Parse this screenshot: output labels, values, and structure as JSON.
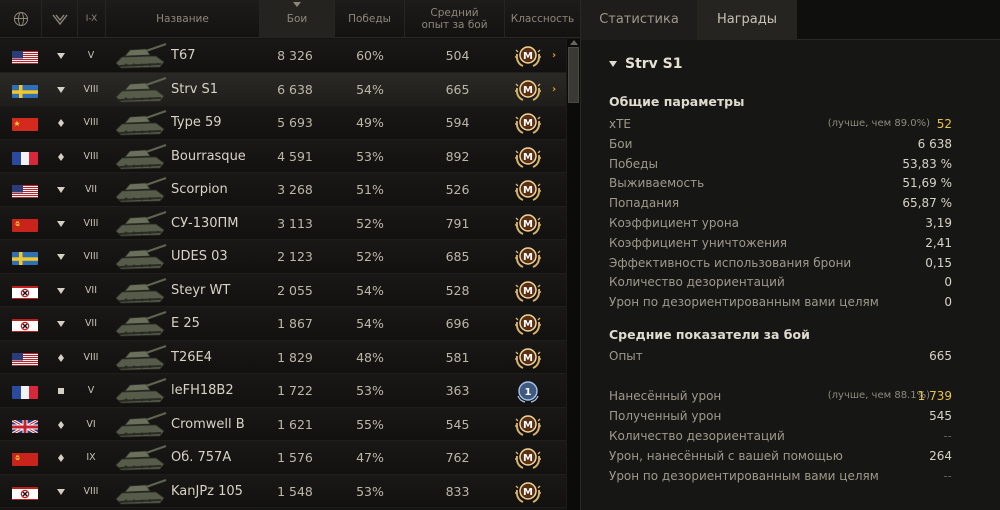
{
  "table": {
    "headers": {
      "nation": "globe-icon",
      "type": "vehicle-type-icon",
      "tier": "I-X",
      "name": "Название",
      "battles": "Бои",
      "wins": "Победы",
      "avg_xp": "Средний опыт за бой",
      "mastery": "Классность"
    },
    "rows": [
      {
        "flag": "usa",
        "type": "triangle",
        "tier": "V",
        "name": "T67",
        "battles": "8 326",
        "wins": "60%",
        "xp": "504",
        "mastery": "M",
        "arrow": "›",
        "selected": false
      },
      {
        "flag": "sweden",
        "type": "triangle",
        "tier": "VIII",
        "name": "Strv S1",
        "battles": "6 638",
        "wins": "54%",
        "xp": "665",
        "mastery": "M",
        "arrow": "›",
        "selected": true
      },
      {
        "flag": "china",
        "type": "diamond",
        "tier": "VIII",
        "name": "Type 59",
        "battles": "5 693",
        "wins": "49%",
        "xp": "594",
        "mastery": "M",
        "arrow": "",
        "selected": false
      },
      {
        "flag": "france",
        "type": "diamond",
        "tier": "VIII",
        "name": "Bourrasque",
        "battles": "4 591",
        "wins": "53%",
        "xp": "892",
        "mastery": "M",
        "arrow": "",
        "selected": false
      },
      {
        "flag": "usa",
        "type": "triangle",
        "tier": "VII",
        "name": "Scorpion",
        "battles": "3 268",
        "wins": "51%",
        "xp": "526",
        "mastery": "M",
        "arrow": "",
        "selected": false
      },
      {
        "flag": "ussr",
        "type": "triangle",
        "tier": "VIII",
        "name": "СУ-130ПМ",
        "battles": "3 113",
        "wins": "52%",
        "xp": "791",
        "mastery": "M",
        "arrow": "",
        "selected": false
      },
      {
        "flag": "sweden",
        "type": "triangle",
        "tier": "VIII",
        "name": "UDES 03",
        "battles": "2 123",
        "wins": "52%",
        "xp": "685",
        "mastery": "M",
        "arrow": "",
        "selected": false
      },
      {
        "flag": "germany",
        "type": "triangle",
        "tier": "VII",
        "name": "Steyr WT",
        "battles": "2 055",
        "wins": "54%",
        "xp": "528",
        "mastery": "M",
        "arrow": "",
        "selected": false
      },
      {
        "flag": "germany",
        "type": "triangle",
        "tier": "VII",
        "name": "E 25",
        "battles": "1 867",
        "wins": "54%",
        "xp": "696",
        "mastery": "M",
        "arrow": "",
        "selected": false
      },
      {
        "flag": "usa",
        "type": "diamond",
        "tier": "VIII",
        "name": "T26E4",
        "battles": "1 829",
        "wins": "48%",
        "xp": "581",
        "mastery": "M",
        "arrow": "",
        "selected": false
      },
      {
        "flag": "france",
        "type": "square",
        "tier": "V",
        "name": "leFH18B2",
        "battles": "1 722",
        "wins": "53%",
        "xp": "363",
        "mastery": "1",
        "arrow": "",
        "selected": false
      },
      {
        "flag": "uk",
        "type": "diamond",
        "tier": "VI",
        "name": "Cromwell B",
        "battles": "1 621",
        "wins": "55%",
        "xp": "545",
        "mastery": "M",
        "arrow": "",
        "selected": false
      },
      {
        "flag": "ussr",
        "type": "diamond",
        "tier": "IX",
        "name": "Об. 757А",
        "battles": "1 576",
        "wins": "47%",
        "xp": "762",
        "mastery": "M",
        "arrow": "",
        "selected": false
      },
      {
        "flag": "germany",
        "type": "triangle",
        "tier": "VIII",
        "name": "KanJPz 105",
        "battles": "1 548",
        "wins": "53%",
        "xp": "833",
        "mastery": "M",
        "arrow": "",
        "selected": false
      }
    ]
  },
  "panel": {
    "tabs": [
      {
        "label": "Статистика",
        "active": true
      },
      {
        "label": "Награды",
        "active": false
      }
    ],
    "vehicle_title": "Strv S1",
    "general": {
      "title": "Общие параметры",
      "stats": [
        {
          "label": "xTE",
          "note": "(лучше, чем 89.0%)",
          "value": "52",
          "gold": true
        },
        {
          "label": "Бои",
          "note": "",
          "value": "6 638",
          "gold": false
        },
        {
          "label": "Победы",
          "note": "",
          "value": "53,83 %",
          "gold": false
        },
        {
          "label": "Выживаемость",
          "note": "",
          "value": "51,69 %",
          "gold": false
        },
        {
          "label": "Попадания",
          "note": "",
          "value": "65,87 %",
          "gold": false
        },
        {
          "label": "Коэффициент урона",
          "note": "",
          "value": "3,19",
          "gold": false
        },
        {
          "label": "Коэффициент уничтожения",
          "note": "",
          "value": "2,41",
          "gold": false
        },
        {
          "label": "Эффективность использования брони",
          "note": "",
          "value": "0,15",
          "gold": false
        },
        {
          "label": "Количество дезориентаций",
          "note": "",
          "value": "0",
          "gold": false
        },
        {
          "label": "Урон по дезориентированным вами целям",
          "note": "",
          "value": "0",
          "gold": false
        }
      ]
    },
    "average": {
      "title": "Средние показатели за бой",
      "stats": [
        {
          "label": "Опыт",
          "note": "",
          "value": "665",
          "gold": false
        },
        {
          "label": "Нанесённый урон",
          "note": "(лучше, чем 88.1%)",
          "value": "1 739",
          "gold": true
        },
        {
          "label": "Полученный урон",
          "note": "",
          "value": "545",
          "gold": false
        },
        {
          "label": "Количество дезориентаций",
          "note": "",
          "value": "--",
          "dim": true
        },
        {
          "label": "Урон, нанесённый с вашей помощью",
          "note": "",
          "value": "264",
          "gold": false
        },
        {
          "label": "Урон по дезориентированным вами целям",
          "note": "",
          "value": "--",
          "dim": true
        }
      ]
    }
  },
  "colors": {
    "accent_gold": "#e8c24a",
    "arrow_orange": "#e09a2a",
    "text_main": "#d8d3c7"
  }
}
